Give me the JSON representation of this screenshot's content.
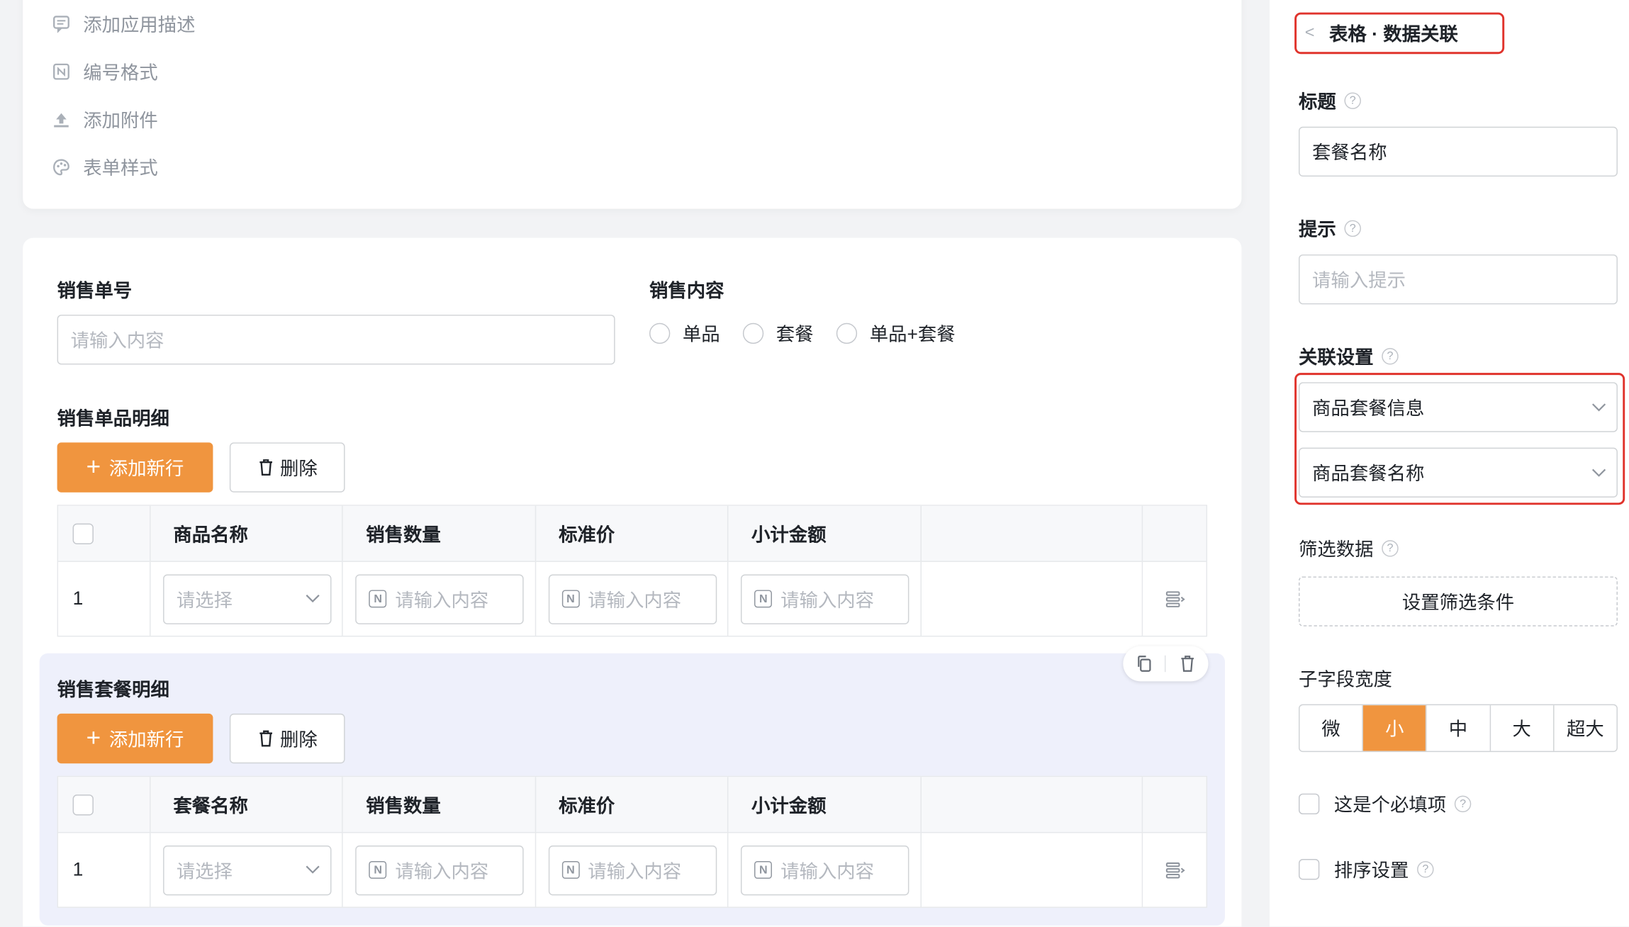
{
  "settings": {
    "items": [
      {
        "label": "添加应用描述",
        "icon": "comment-icon"
      },
      {
        "label": "编号格式",
        "icon": "number-format-icon"
      },
      {
        "label": "添加附件",
        "icon": "upload-icon"
      },
      {
        "label": "表单样式",
        "icon": "palette-icon"
      }
    ]
  },
  "form": {
    "order_no_label": "销售单号",
    "order_no_placeholder": "请输入内容",
    "content_label": "销售内容",
    "content_options": [
      "单品",
      "套餐",
      "单品+套餐"
    ],
    "single_section": {
      "title": "销售单品明细",
      "add_label": "添加新行",
      "delete_label": "删除",
      "headers": [
        "商品名称",
        "销售数量",
        "标准价",
        "小计金额"
      ],
      "row_index": "1",
      "select_placeholder": "请选择",
      "input_placeholder": "请输入内容"
    },
    "combo_section": {
      "title": "销售套餐明细",
      "add_label": "添加新行",
      "delete_label": "删除",
      "headers": [
        "套餐名称",
        "销售数量",
        "标准价",
        "小计金额"
      ],
      "row_index": "1",
      "select_placeholder": "请选择",
      "input_placeholder": "请输入内容"
    }
  },
  "panel": {
    "header": "表格 · 数据关联",
    "title_label": "标题",
    "title_value": "套餐名称",
    "hint_label": "提示",
    "hint_placeholder": "请输入提示",
    "relation_label": "关联设置",
    "relation_source": "商品套餐信息",
    "relation_field": "商品套餐名称",
    "filter_label": "筛选数据",
    "filter_button": "设置筛选条件",
    "width_label": "子字段宽度",
    "width_options": [
      "微",
      "小",
      "中",
      "大",
      "超大"
    ],
    "width_selected": "小",
    "required_label": "这是个必填项",
    "sort_label": "排序设置"
  },
  "colors": {
    "accent": "#f0953f",
    "highlight_border": "#e0332c",
    "selected_block_bg": "#eef0fb"
  }
}
